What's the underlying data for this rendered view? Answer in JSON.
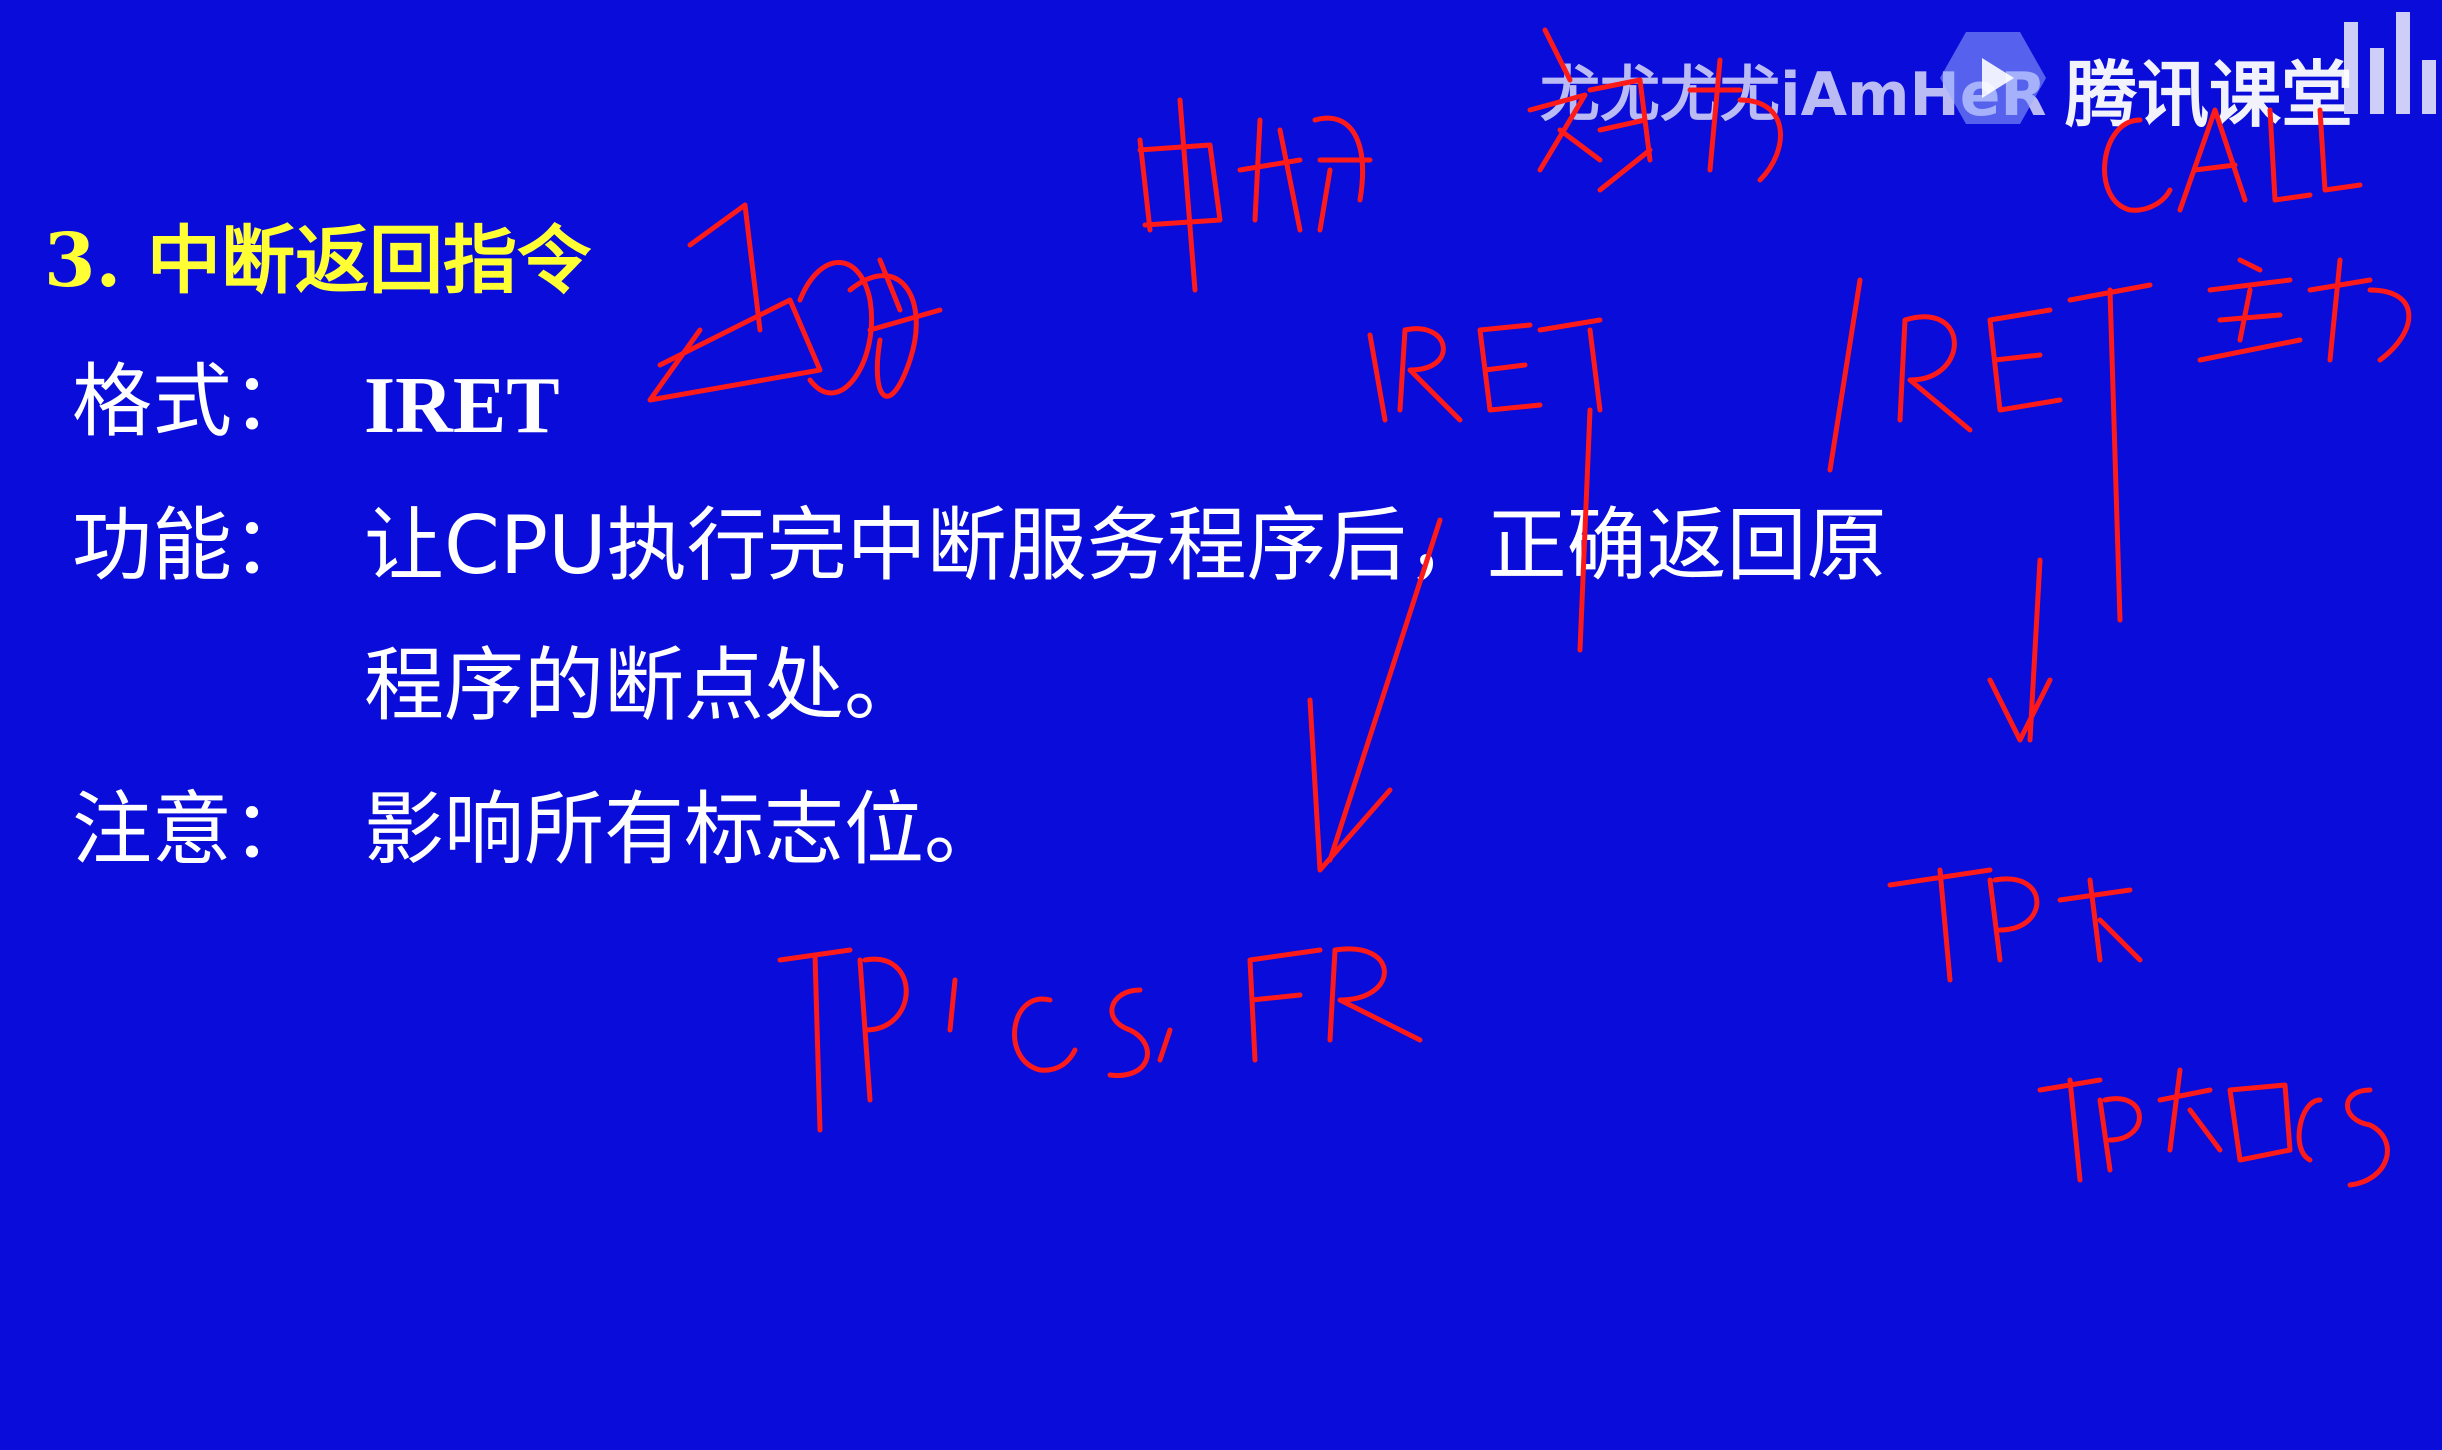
{
  "slide": {
    "heading": "3. 中断返回指令",
    "rows": [
      {
        "label": "格式：",
        "value": "IRET"
      },
      {
        "label": "功能：",
        "value": "让CPU执行完中断服务程序后，正确返回原"
      },
      {
        "label": "",
        "value": "程序的断点处。"
      },
      {
        "label": "注意：",
        "value": "影响所有标志位。"
      }
    ]
  },
  "watermark": {
    "user_text": "尤尤尤尤iAmHeR",
    "brand": "腾讯课堂"
  },
  "handwriting": {
    "notes": [
      "中断",
      "被动",
      "CALL",
      "主动",
      "IRET",
      "IRET",
      "IP, CS, FR",
      "IP 和 CS"
    ],
    "color": "#ff1a1a"
  },
  "colors": {
    "background": "#0a0cd9",
    "heading": "#ffff33",
    "body_text": "#ffffff",
    "ink": "#ff1a1a"
  }
}
